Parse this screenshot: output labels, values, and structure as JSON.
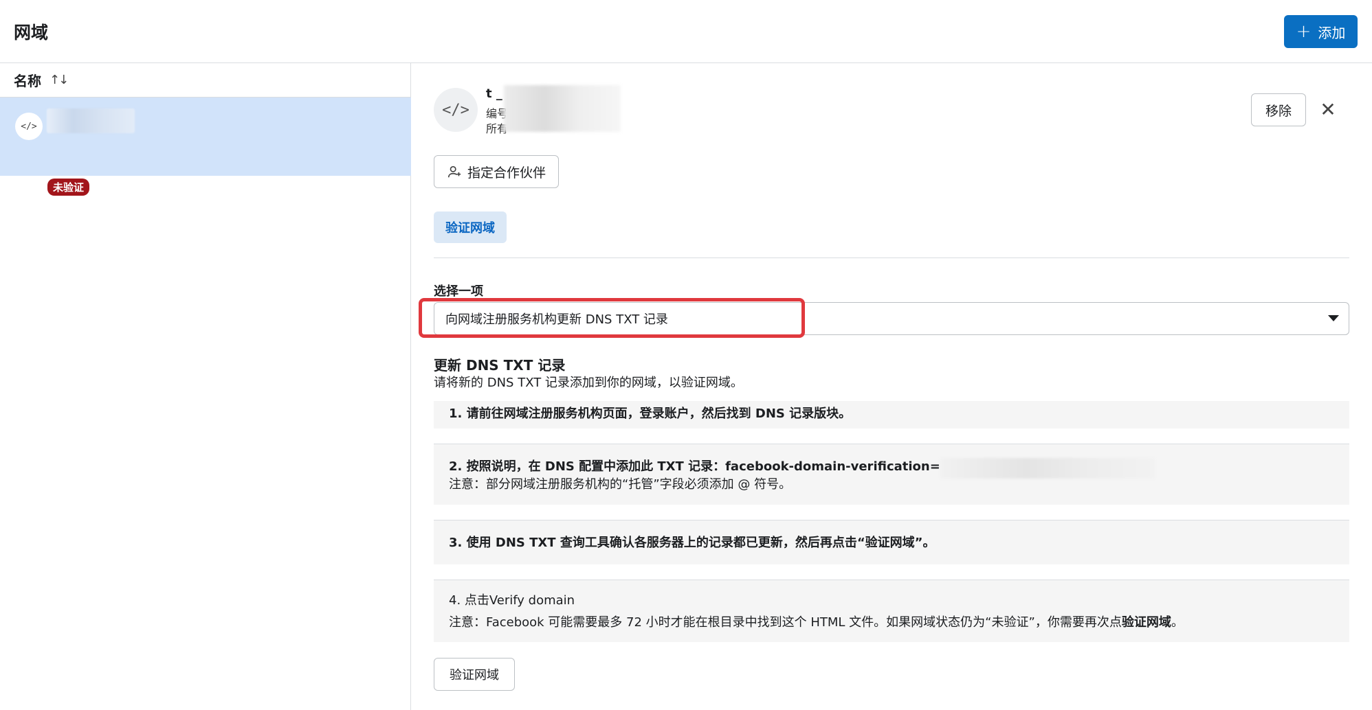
{
  "header": {
    "title": "网域",
    "add_label": "添加",
    "add_icon": "plus-icon"
  },
  "list": {
    "column_label": "名称",
    "sort_icon": "sort-arrows-icon",
    "items": [
      {
        "icon": "code-icon",
        "status": "未验证"
      }
    ]
  },
  "detail": {
    "domain_icon": "code-icon",
    "domain_title_visible": "t _",
    "meta1_prefix": "编号",
    "meta2_prefix": "所有",
    "remove_label": "移除",
    "close_icon": "close-icon",
    "partner_button": "指定合作伙伴",
    "partner_icon": "add-person-icon",
    "tab_label": "验证网域",
    "select": {
      "label": "选择一项",
      "value": "向网域注册服务机构更新 DNS TXT 记录"
    },
    "section_title": "更新 DNS TXT 记录",
    "section_subtitle": "请将新的 DNS TXT 记录添加到你的网域，以验证网域。",
    "steps": [
      {
        "text": "1. 请前往网域注册服务机构页面，登录账户，然后找到 DNS 记录版块。"
      },
      {
        "text": "2. 按照说明，在 DNS 配置中添加此 TXT 记录：facebook-domain-verification=",
        "note": "注意：部分网域注册服务机构的“托管”字段必须添加 @ 符号。"
      },
      {
        "text": "3. 使用 DNS TXT 查询工具确认各服务器上的记录都已更新，然后再点击“验证网域”。"
      },
      {
        "text": "4. 点击Verify domain",
        "note_prefix": "注意：Facebook 可能需要最多 72 小时才能在根目录中找到这个 HTML 文件。如果网域状态仍为“未验证”，你需要再次点",
        "note_bold": "验证网域",
        "note_suffix": "。"
      }
    ],
    "verify_button": "验证网域"
  },
  "colors": {
    "primary": "#0a6fc2",
    "selected_row": "#d1e3fa",
    "badge": "#a2151b",
    "highlight": "#e0393e"
  }
}
